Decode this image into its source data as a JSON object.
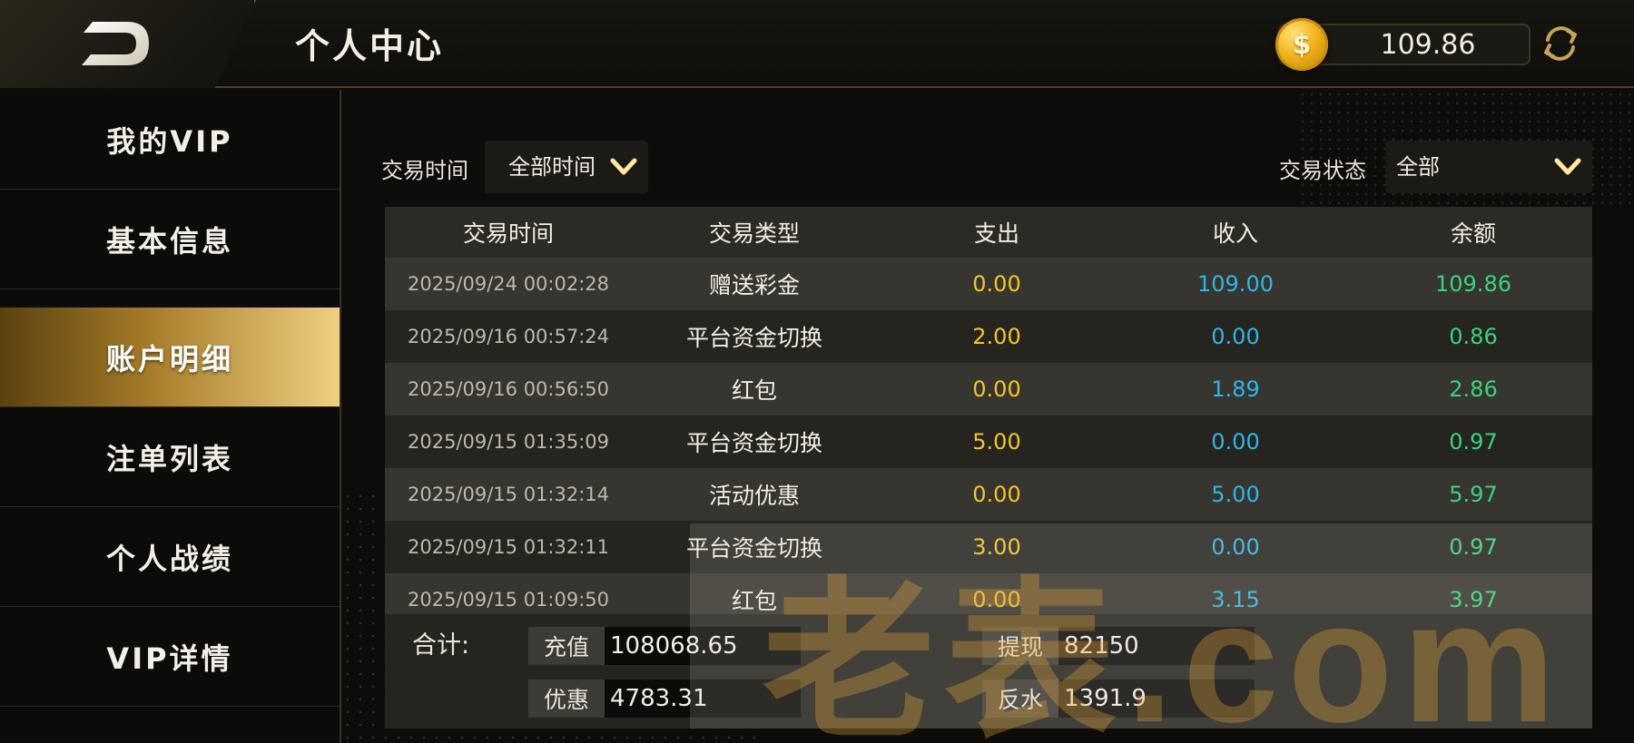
{
  "header": {
    "title": "个人中心",
    "balance": "109.86",
    "coin_symbol": "$"
  },
  "sidebar": {
    "items": [
      {
        "label": "我的VIP"
      },
      {
        "label": "基本信息"
      },
      {
        "label": "账户明细",
        "active": true
      },
      {
        "label": "注单列表"
      },
      {
        "label": "个人战绩"
      },
      {
        "label": "VIP详情"
      }
    ]
  },
  "filters": {
    "time_label": "交易时间",
    "time_value": "全部时间",
    "status_label": "交易状态",
    "status_value": "全部"
  },
  "table": {
    "headers": [
      "交易时间",
      "交易类型",
      "支出",
      "收入",
      "余额"
    ],
    "rows": [
      {
        "time": "2025/09/24 00:02:28",
        "type": "赠送彩金",
        "out": "0.00",
        "in": "109.00",
        "bal": "109.86"
      },
      {
        "time": "2025/09/16 00:57:24",
        "type": "平台资金切换",
        "out": "2.00",
        "in": "0.00",
        "bal": "0.86"
      },
      {
        "time": "2025/09/16 00:56:50",
        "type": "红包",
        "out": "0.00",
        "in": "1.89",
        "bal": "2.86"
      },
      {
        "time": "2025/09/15 01:35:09",
        "type": "平台资金切换",
        "out": "5.00",
        "in": "0.00",
        "bal": "0.97"
      },
      {
        "time": "2025/09/15 01:32:14",
        "type": "活动优惠",
        "out": "0.00",
        "in": "5.00",
        "bal": "5.97"
      },
      {
        "time": "2025/09/15 01:32:11",
        "type": "平台资金切换",
        "out": "3.00",
        "in": "0.00",
        "bal": "0.97"
      },
      {
        "time": "2025/09/15 01:09:50",
        "type": "红包",
        "out": "0.00",
        "in": "3.15",
        "bal": "3.97"
      }
    ]
  },
  "summary": {
    "label": "合计:",
    "recharge_label": "充值",
    "recharge_value": "108068.65",
    "withdraw_label": "提现",
    "withdraw_value": "82150",
    "promo_label": "优惠",
    "promo_value": "4783.31",
    "rebate_label": "反水",
    "rebate_value": "1391.9"
  },
  "watermark": "老表.com",
  "colors": {
    "accent_gold": "#d9b56a",
    "expense": "#f2c42c",
    "income": "#2fb6e8",
    "balance": "#39d37e"
  }
}
